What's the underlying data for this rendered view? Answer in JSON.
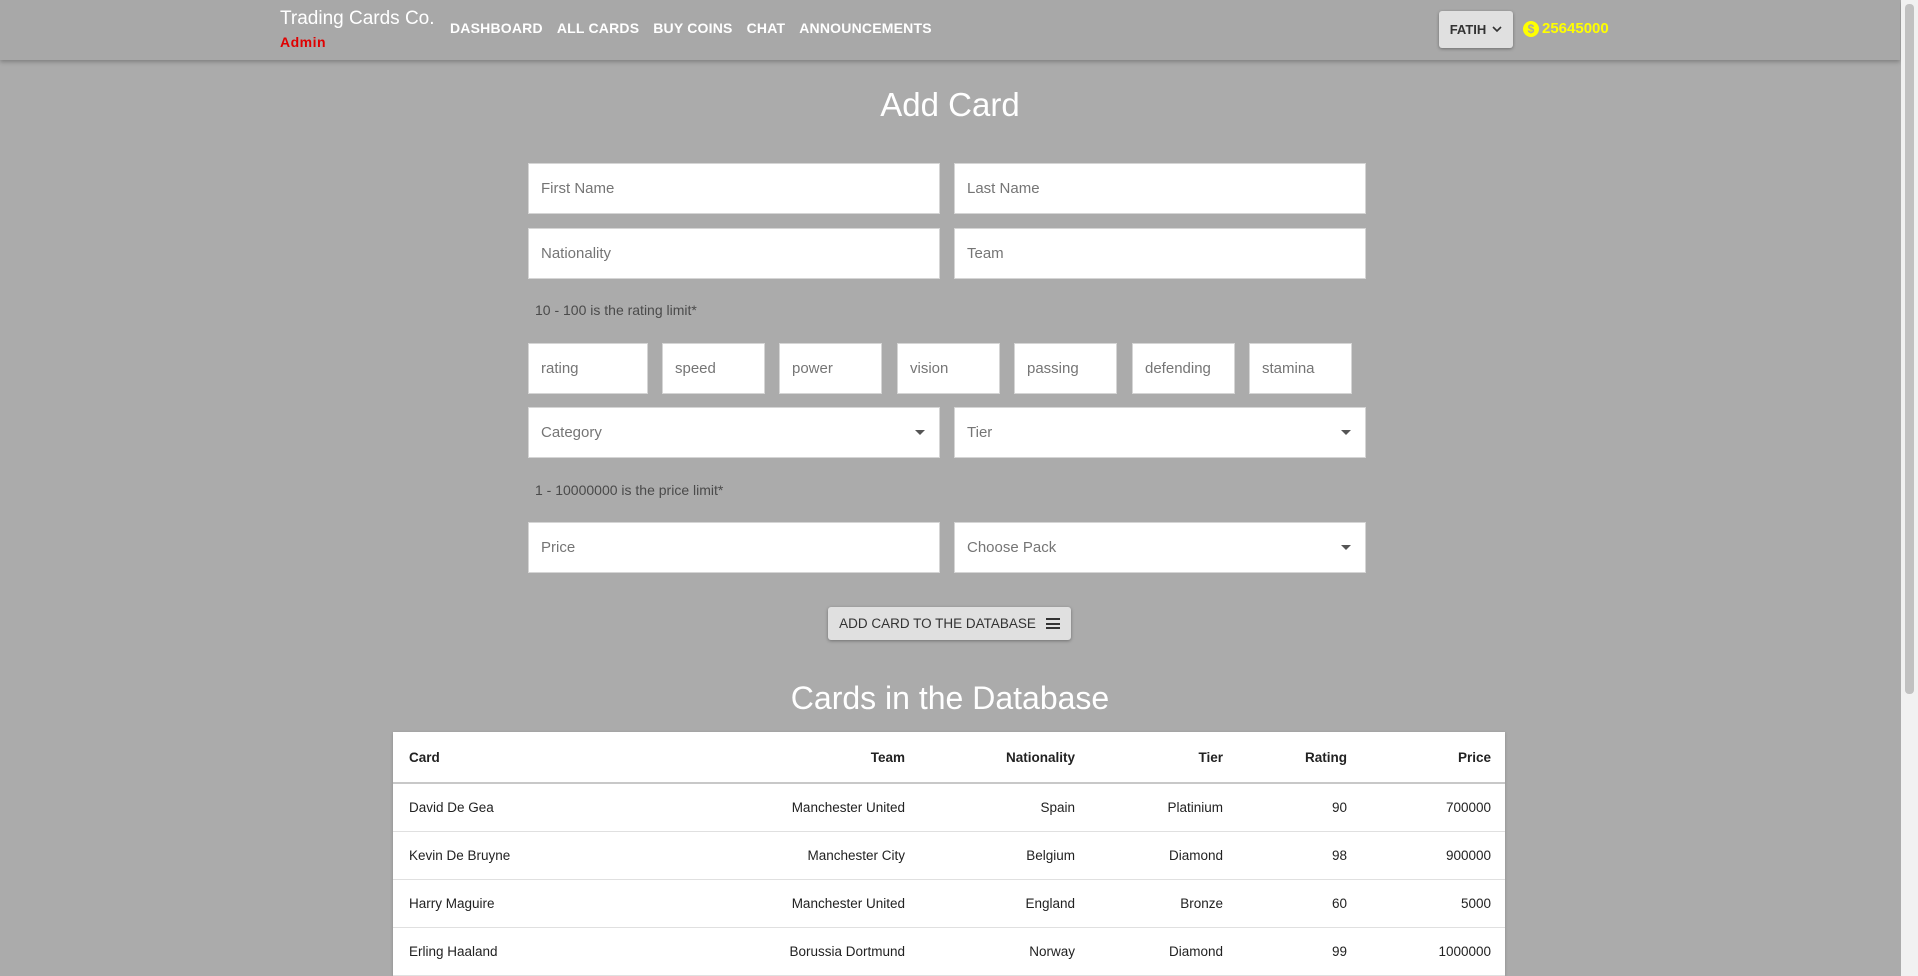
{
  "nav": {
    "brand": "Trading Cards Co.",
    "role": "Admin",
    "links": [
      "DASHBOARD",
      "ALL CARDS",
      "BUY COINS",
      "CHAT",
      "ANNOUNCEMENTS"
    ],
    "user": "FATIH",
    "coin_symbol": "$",
    "coins": "25645000"
  },
  "form": {
    "title": "Add Card",
    "first_name": "First Name",
    "last_name": "Last Name",
    "nationality": "Nationality",
    "team": "Team",
    "rating_hint": "10 - 100 is the rating limit*",
    "stats": [
      "rating",
      "speed",
      "power",
      "vision",
      "passing",
      "defending",
      "stamina"
    ],
    "category": "Category",
    "tier": "Tier",
    "price_hint": "1 - 10000000 is the price limit*",
    "price": "Price",
    "pack": "Choose Pack",
    "submit": "ADD CARD TO THE DATABASE"
  },
  "table": {
    "title": "Cards in the Database",
    "headers": [
      "Card",
      "Team",
      "Nationality",
      "Tier",
      "Rating",
      "Price"
    ],
    "rows": [
      [
        "David De Gea",
        "Manchester United",
        "Spain",
        "Platinium",
        "90",
        "700000"
      ],
      [
        "Kevin De Bruyne",
        "Manchester City",
        "Belgium",
        "Diamond",
        "98",
        "900000"
      ],
      [
        "Harry Maguire",
        "Manchester United",
        "England",
        "Bronze",
        "60",
        "5000"
      ],
      [
        "Erling Haaland",
        "Borussia Dortmund",
        "Norway",
        "Diamond",
        "99",
        "1000000"
      ]
    ]
  },
  "colors": {
    "background": "#ababab",
    "brand_sub": "#e00000",
    "coins": "#ffff00"
  }
}
